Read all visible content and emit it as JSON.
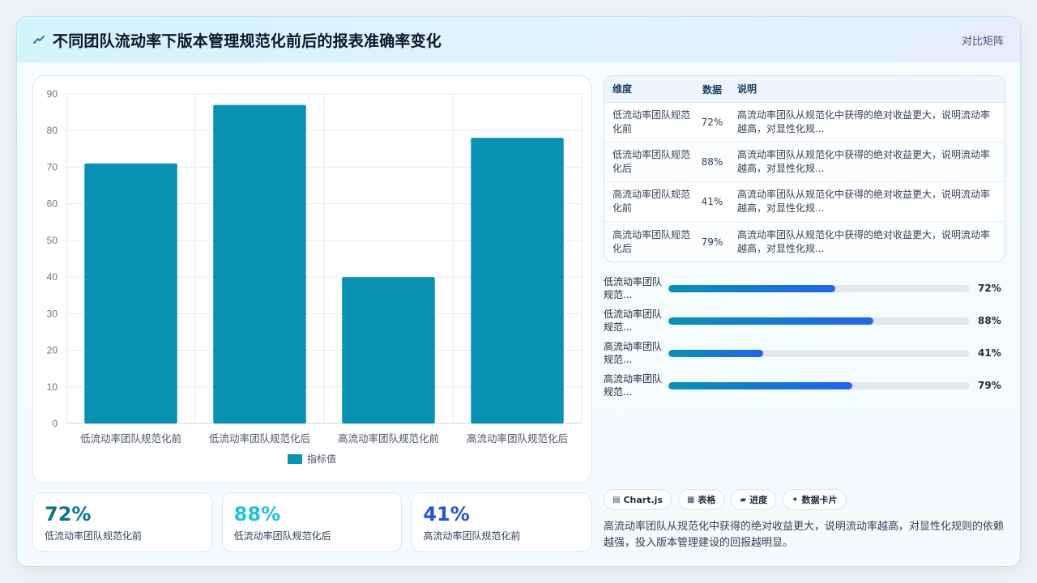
{
  "header": {
    "title": "不同团队流动率下版本管理规范化前后的报表准确率变化",
    "tag": "对比矩阵",
    "icon": "trend-icon"
  },
  "chart_data": {
    "type": "bar",
    "categories": [
      "低流动率团队规范化前",
      "低流动率团队规范化后",
      "高流动率团队规范化前",
      "高流动率团队规范化后"
    ],
    "series": [
      {
        "name": "指标值",
        "values": [
          71,
          87,
          40,
          78
        ],
        "color": "#0891b2"
      }
    ],
    "ylim": [
      0,
      90
    ],
    "yticks": [
      0,
      10,
      20,
      30,
      40,
      50,
      60,
      70,
      80,
      90
    ],
    "grid": true,
    "legend": "bottom"
  },
  "table": {
    "headers": [
      "维度",
      "数据",
      "说明"
    ],
    "rows": [
      {
        "dim": "低流动率团队规范化前",
        "value": "72%",
        "desc": "高流动率团队从规范化中获得的绝对收益更大，说明流动率越高，对显性化规..."
      },
      {
        "dim": "低流动率团队规范化后",
        "value": "88%",
        "desc": "高流动率团队从规范化中获得的绝对收益更大，说明流动率越高，对显性化规..."
      },
      {
        "dim": "高流动率团队规范化前",
        "value": "41%",
        "desc": "高流动率团队从规范化中获得的绝对收益更大，说明流动率越高，对显性化规..."
      },
      {
        "dim": "高流动率团队规范化后",
        "value": "79%",
        "desc": "高流动率团队从规范化中获得的绝对收益更大，说明流动率越高，对显性化规..."
      }
    ]
  },
  "progress": [
    {
      "label": "低流动率团队规范...",
      "percent": 55.5,
      "value": "72%"
    },
    {
      "label": "低流动率团队规范...",
      "percent": 68,
      "value": "88%"
    },
    {
      "label": "高流动率团队规范...",
      "percent": 31.5,
      "value": "41%"
    },
    {
      "label": "高流动率团队规范...",
      "percent": 61,
      "value": "79%"
    }
  ],
  "stats": [
    {
      "value": "72%",
      "label": "低流动率团队规范化前",
      "color": "#0e7490"
    },
    {
      "value": "88%",
      "label": "低流动率团队规范化后",
      "color": "#22c3de"
    },
    {
      "value": "41%",
      "label": "高流动率团队规范化前",
      "color": "#2554d6"
    }
  ],
  "chips": [
    {
      "icon": "▤",
      "label": "Chart.js"
    },
    {
      "icon": "▦",
      "label": "表格"
    },
    {
      "icon": "▰",
      "label": "进度"
    },
    {
      "icon": "✦",
      "label": "数据卡片"
    }
  ],
  "summary": "高流动率团队从规范化中获得的绝对收益更大，说明流动率越高，对显性化规则的依赖越强，投入版本管理建设的回报越明显。"
}
